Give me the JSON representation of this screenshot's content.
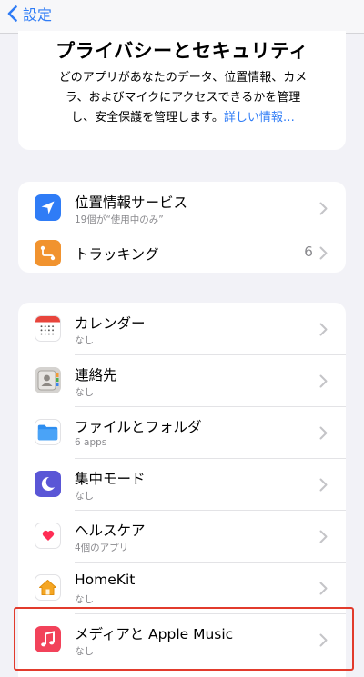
{
  "nav": {
    "back_label": "設定"
  },
  "header": {
    "title": "プライバシーとセキュリティ",
    "desc_line1": "どのアプリがあなたのデータ、位置情報、カメ",
    "desc_line2": "ラ、およびマイクにアクセスできるかを管理",
    "desc_line3": "し、安全保護を管理します。",
    "link": "詳しい情報…"
  },
  "group1": [
    {
      "title": "位置情報サービス",
      "subtitle": "19個が“使用中のみ”",
      "icon": "location-arrow-icon",
      "color": "#2f7cf6"
    },
    {
      "title": "トラッキング",
      "value": "6",
      "icon": "tracking-icon",
      "color": "#f1932f"
    }
  ],
  "group2": [
    {
      "title": "カレンダー",
      "subtitle": "なし",
      "icon": "calendar-icon"
    },
    {
      "title": "連絡先",
      "subtitle": "なし",
      "icon": "contacts-icon"
    },
    {
      "title": "ファイルとフォルダ",
      "subtitle": "6 apps",
      "icon": "folder-icon",
      "color": "#2e8ef0"
    },
    {
      "title": "集中モード",
      "subtitle": "なし",
      "icon": "moon-icon",
      "color": "#5a56d6"
    },
    {
      "title": "ヘルスケア",
      "subtitle": "4個のアプリ",
      "icon": "heart-icon",
      "color": "#ff2d55"
    },
    {
      "title": "HomeKit",
      "subtitle": "なし",
      "icon": "home-icon",
      "color": "#f5a623"
    },
    {
      "title": "メディアと Apple Music",
      "subtitle": "なし",
      "icon": "music-note-icon",
      "color": "#f2425a"
    }
  ],
  "highlight_color": "#e23b2c"
}
